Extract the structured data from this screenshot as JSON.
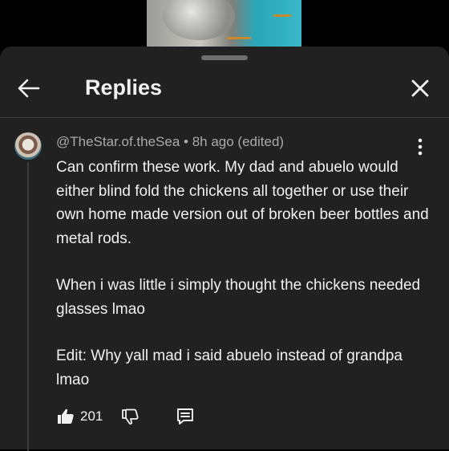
{
  "header": {
    "title": "Replies"
  },
  "comment": {
    "author": "@TheStar.of.theSea",
    "separator": " • ",
    "time": "8h ago (edited)",
    "paragraphs": [
      "Can confirm these work. My dad and abuelo would either blind fold the chickens all together or use their own home made version out of broken beer bottles and metal rods.",
      "When i was little i simply thought the chickens needed glasses lmao",
      "Edit: Why yall mad i said abuelo instead of grandpa lmao"
    ],
    "like_count": "201"
  },
  "icons": {
    "back": "arrow-left-icon",
    "close": "close-icon",
    "more": "more-vertical-icon",
    "like": "thumbs-up-icon",
    "dislike": "thumbs-down-icon",
    "reply": "comment-icon"
  },
  "colors": {
    "sheet_background": "#212121",
    "text_primary": "#f1f1f1",
    "text_secondary": "#aaaaaa"
  }
}
